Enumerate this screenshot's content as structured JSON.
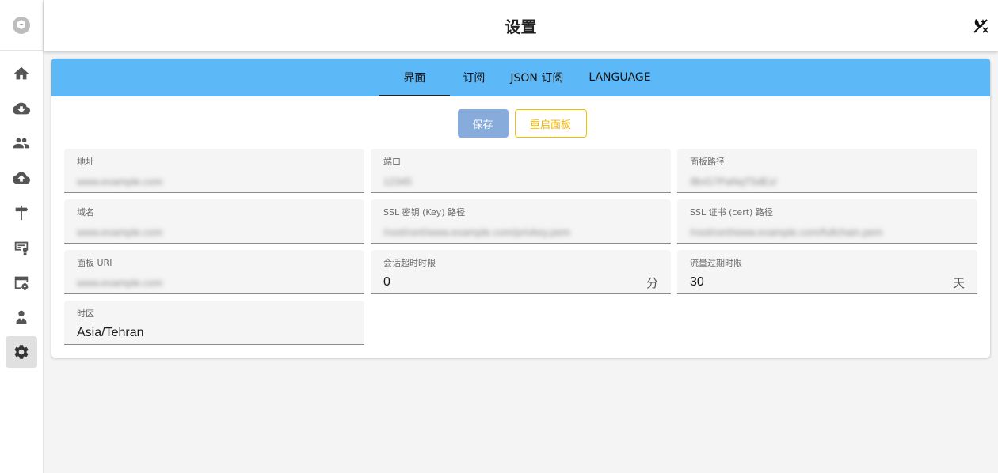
{
  "header": {
    "title": "设置"
  },
  "sidebar": {
    "items": [
      {
        "name": "home"
      },
      {
        "name": "inbounds-download"
      },
      {
        "name": "clients"
      },
      {
        "name": "outbounds-upload"
      },
      {
        "name": "routing"
      },
      {
        "name": "certificates"
      },
      {
        "name": "panel-settings"
      },
      {
        "name": "admins"
      },
      {
        "name": "settings",
        "active": true
      }
    ]
  },
  "tabs": [
    {
      "label": "界面",
      "active": true
    },
    {
      "label": "订阅",
      "active": false
    },
    {
      "label": "JSON 订阅",
      "active": false
    },
    {
      "label": "LANGUAGE",
      "active": false
    }
  ],
  "actions": {
    "save_label": "保存",
    "restart_label": "重启面板"
  },
  "fields": {
    "address": {
      "label": "地址",
      "value": "www.example.com"
    },
    "port": {
      "label": "端口",
      "value": "12345"
    },
    "panel_path": {
      "label": "面板路径",
      "value": "/BvG7PaNqT5dEz/"
    },
    "domain": {
      "label": "域名",
      "value": "www.example.com"
    },
    "ssl_key": {
      "label": "SSL 密钥 (Key) 路径",
      "value": "/root/cert/www.example.com/privkey.pem"
    },
    "ssl_cert": {
      "label": "SSL 证书 (cert) 路径",
      "value": "/root/cert/www.example.com/fullchain.pem"
    },
    "panel_uri": {
      "label": "面板 URI",
      "value": "www.example.com"
    },
    "session_timeout": {
      "label": "会话超时时限",
      "value": "0",
      "suffix": "分"
    },
    "traffic_expire": {
      "label": "流量过期时限",
      "value": "30",
      "suffix": "天"
    },
    "timezone": {
      "label": "时区",
      "value": "Asia/Tehran"
    }
  },
  "colors": {
    "tab_bar": "#5db8f7",
    "save_button": "#87acdc",
    "restart_border": "#f2c200"
  }
}
